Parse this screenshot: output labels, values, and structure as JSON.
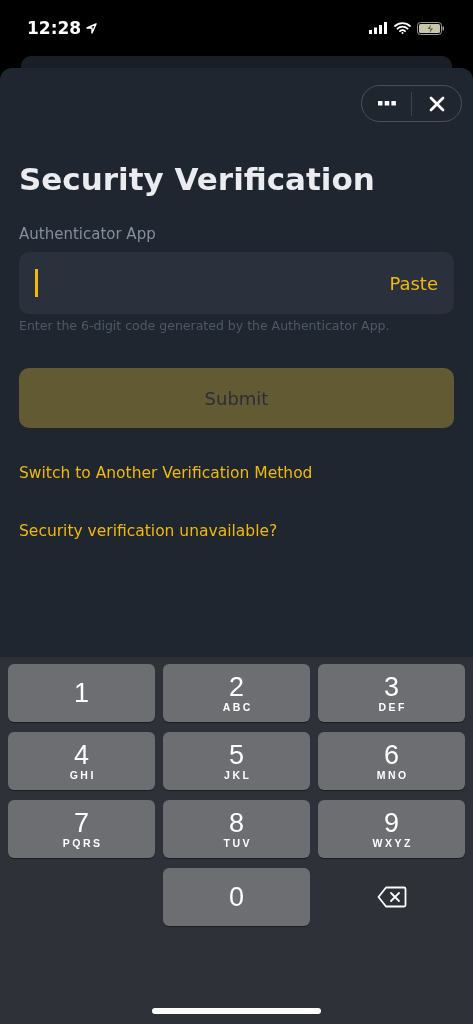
{
  "status_bar": {
    "time": "12:28"
  },
  "header": {
    "title": "Security Verification"
  },
  "field": {
    "label": "Authenticator App",
    "action": "Paste",
    "focused": true,
    "hint": "Enter the 6-digit code generated by the Authenticator App."
  },
  "submit": {
    "label": "Submit",
    "disabled": true
  },
  "links": [
    "Switch to Another Verification Method",
    "Security verification unavailable?"
  ],
  "keypad": [
    {
      "kind": "digit",
      "digit": "1"
    },
    {
      "kind": "digit",
      "digit": "2",
      "letters": "ABC"
    },
    {
      "kind": "digit",
      "digit": "3",
      "letters": "DEF"
    },
    {
      "kind": "digit",
      "digit": "4",
      "letters": "GHI"
    },
    {
      "kind": "digit",
      "digit": "5",
      "letters": "JKL"
    },
    {
      "kind": "digit",
      "digit": "6",
      "letters": "MNO"
    },
    {
      "kind": "digit",
      "digit": "7",
      "letters": "PQRS"
    },
    {
      "kind": "digit",
      "digit": "8",
      "letters": "TUV"
    },
    {
      "kind": "digit",
      "digit": "9",
      "letters": "WXYZ"
    },
    {
      "kind": "blank"
    },
    {
      "kind": "digit",
      "digit": "0"
    },
    {
      "kind": "backspace"
    }
  ]
}
